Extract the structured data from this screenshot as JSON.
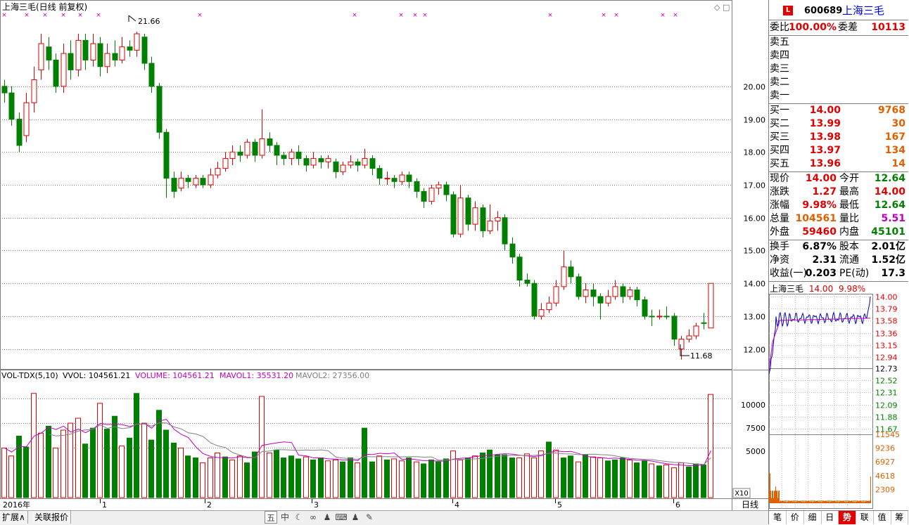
{
  "main": {
    "title": "上海三毛(日线 前复权)",
    "high_marker": "21.66",
    "low_marker": "11.68",
    "price_axis": [
      "20.00",
      "19.00",
      "18.00",
      "17.00",
      "16.00",
      "15.00",
      "14.00",
      "13.00",
      "12.00"
    ],
    "vol_header": {
      "name": "VOL-TDX(5,10)",
      "vvol": "VVOL: 104561.21",
      "volume": "VOLUME: 104561.21",
      "mavol1": "MAVOL1: 35531.20",
      "mavol2": "MAVOL2: 27356.00"
    },
    "vol_axis": [
      "10000",
      "7500",
      "5000"
    ],
    "vol_unit": "X10",
    "date_labels": [
      "2016年",
      "1",
      "2",
      "3",
      "4",
      "5",
      "6"
    ],
    "period_label": "日线"
  },
  "bottom_bar": {
    "tabs": [
      "扩展∧",
      "关联报价"
    ],
    "tools": [
      "五",
      "中",
      "☾",
      "∞",
      "♟",
      "⌨",
      "♟",
      "✎"
    ]
  },
  "quote": {
    "code": "600689",
    "name": "上海三毛",
    "logo": "L",
    "weibi_label": "委比",
    "weibi": "100.00%",
    "weicha_label": "委差",
    "weicha": "10113",
    "sell": [
      {
        "label": "卖五",
        "price": "",
        "vol": ""
      },
      {
        "label": "卖四",
        "price": "",
        "vol": ""
      },
      {
        "label": "卖三",
        "price": "",
        "vol": ""
      },
      {
        "label": "卖二",
        "price": "",
        "vol": ""
      },
      {
        "label": "卖一",
        "price": "",
        "vol": ""
      }
    ],
    "buy": [
      {
        "label": "买一",
        "price": "14.00",
        "vol": "9768"
      },
      {
        "label": "买二",
        "price": "13.99",
        "vol": "30"
      },
      {
        "label": "买三",
        "price": "13.98",
        "vol": "167"
      },
      {
        "label": "买四",
        "price": "13.97",
        "vol": "134"
      },
      {
        "label": "买五",
        "price": "13.96",
        "vol": "14"
      }
    ],
    "stats": [
      {
        "l1": "现价",
        "v1": "14.00",
        "c1": "red",
        "l2": "今开",
        "v2": "12.64",
        "c2": "green"
      },
      {
        "l1": "涨跌",
        "v1": "1.27",
        "c1": "red",
        "l2": "最高",
        "v2": "14.00",
        "c2": "red"
      },
      {
        "l1": "涨幅",
        "v1": "9.98%",
        "c1": "red",
        "l2": "最低",
        "v2": "12.64",
        "c2": "green"
      },
      {
        "l1": "总量",
        "v1": "104561",
        "c1": "orange",
        "l2": "量比",
        "v2": "5.51",
        "c2": "purple"
      },
      {
        "l1": "外盘",
        "v1": "59460",
        "c1": "red",
        "l2": "内盘",
        "v2": "45101",
        "c2": "green"
      }
    ],
    "stats2": [
      {
        "l1": "换手",
        "v1": "6.87%",
        "l2": "股本",
        "v2": "2.01亿"
      },
      {
        "l1": "净资",
        "v1": "2.31",
        "l2": "流通",
        "v2": "1.52亿"
      },
      {
        "l1": "收益(一)",
        "v1": "0.203",
        "l2": "PE(动)",
        "v2": "17.3"
      }
    ],
    "mini_title": "上海三毛",
    "mini_price": "14.00",
    "mini_pct": "9.98%",
    "mini_price_axis": [
      "14.00",
      "13.79",
      "13.58",
      "13.36",
      "13.15",
      "12.94",
      "12.73",
      "12.52",
      "12.31",
      "12.09",
      "11.88",
      "11.67"
    ],
    "mini_vol_axis": [
      "11545",
      "9236",
      "6927",
      "4618",
      "2309"
    ],
    "tabs": [
      "笔",
      "价",
      "细",
      "日",
      "势",
      "联",
      "值",
      "筹"
    ],
    "active_tab": "势"
  },
  "chart_data": {
    "type": "candlestick",
    "price_range": [
      11.5,
      22.2
    ],
    "volume_range": [
      0,
      11545
    ],
    "candles": [
      [
        20.0,
        19.8,
        20.2,
        19.5,
        "d"
      ],
      [
        19.8,
        19.0,
        20.0,
        18.8,
        "d"
      ],
      [
        19.0,
        18.2,
        19.2,
        18.0,
        "d"
      ],
      [
        18.5,
        19.5,
        19.8,
        18.3,
        "u"
      ],
      [
        19.5,
        20.2,
        20.6,
        19.2,
        "u"
      ],
      [
        20.5,
        21.3,
        21.6,
        20.2,
        "u"
      ],
      [
        21.2,
        20.8,
        21.5,
        20.5,
        "d"
      ],
      [
        20.8,
        20.0,
        21.0,
        19.8,
        "d"
      ],
      [
        20.0,
        21.0,
        21.3,
        19.8,
        "u"
      ],
      [
        21.0,
        20.5,
        21.4,
        20.2,
        "d"
      ],
      [
        20.5,
        21.4,
        21.6,
        20.3,
        "u"
      ],
      [
        21.4,
        20.8,
        21.6,
        20.5,
        "d"
      ],
      [
        20.8,
        21.3,
        21.6,
        20.6,
        "u"
      ],
      [
        21.3,
        20.6,
        21.5,
        20.3,
        "d"
      ],
      [
        20.6,
        21.0,
        21.3,
        20.4,
        "u"
      ],
      [
        21.0,
        20.8,
        21.4,
        20.6,
        "d"
      ],
      [
        20.8,
        21.2,
        21.5,
        20.7,
        "u"
      ],
      [
        21.2,
        21.1,
        21.4,
        20.9,
        "d"
      ],
      [
        21.1,
        21.6,
        21.66,
        20.9,
        "u"
      ],
      [
        21.5,
        20.7,
        21.6,
        20.5,
        "d"
      ],
      [
        20.7,
        20.0,
        20.9,
        19.8,
        "d"
      ],
      [
        20.0,
        18.6,
        20.1,
        18.4,
        "d"
      ],
      [
        18.6,
        17.2,
        18.7,
        16.6,
        "d"
      ],
      [
        17.2,
        16.8,
        17.4,
        16.6,
        "d"
      ],
      [
        16.9,
        17.2,
        17.4,
        16.8,
        "u"
      ],
      [
        17.2,
        17.1,
        17.3,
        16.9,
        "d"
      ],
      [
        17.0,
        17.2,
        17.3,
        16.9,
        "u"
      ],
      [
        17.2,
        17.0,
        17.3,
        16.9,
        "d"
      ],
      [
        17.0,
        17.3,
        17.5,
        16.9,
        "u"
      ],
      [
        17.3,
        17.5,
        17.7,
        17.2,
        "u"
      ],
      [
        17.5,
        17.8,
        18.0,
        17.4,
        "u"
      ],
      [
        17.8,
        18.0,
        18.2,
        17.6,
        "u"
      ],
      [
        18.0,
        17.9,
        18.2,
        17.7,
        "d"
      ],
      [
        17.9,
        18.3,
        18.4,
        17.8,
        "u"
      ],
      [
        18.3,
        17.9,
        18.4,
        17.7,
        "d"
      ],
      [
        17.9,
        18.4,
        19.3,
        17.8,
        "u"
      ],
      [
        18.4,
        18.2,
        18.6,
        18.0,
        "d"
      ],
      [
        18.2,
        17.9,
        18.3,
        17.6,
        "d"
      ],
      [
        17.9,
        17.8,
        18.0,
        17.6,
        "d"
      ],
      [
        17.8,
        18.0,
        18.1,
        17.6,
        "u"
      ],
      [
        18.0,
        17.8,
        18.2,
        17.6,
        "d"
      ],
      [
        17.8,
        17.6,
        17.9,
        17.4,
        "d"
      ],
      [
        17.6,
        17.8,
        18.0,
        17.5,
        "u"
      ],
      [
        17.8,
        17.7,
        17.9,
        17.5,
        "d"
      ],
      [
        17.7,
        17.8,
        17.9,
        17.5,
        "u"
      ],
      [
        17.7,
        17.4,
        17.8,
        17.2,
        "d"
      ],
      [
        17.4,
        17.6,
        17.7,
        17.3,
        "u"
      ],
      [
        17.6,
        17.7,
        17.9,
        17.5,
        "u"
      ],
      [
        17.7,
        17.6,
        17.8,
        17.4,
        "d"
      ],
      [
        17.6,
        17.8,
        18.1,
        17.5,
        "u"
      ],
      [
        17.8,
        17.5,
        17.9,
        17.3,
        "d"
      ],
      [
        17.5,
        17.2,
        17.6,
        17.0,
        "d"
      ],
      [
        17.2,
        17.2,
        17.4,
        17.0,
        "u"
      ],
      [
        17.2,
        17.1,
        17.3,
        16.9,
        "d"
      ],
      [
        17.1,
        17.3,
        17.4,
        17.0,
        "u"
      ],
      [
        17.3,
        17.1,
        17.4,
        16.9,
        "d"
      ],
      [
        17.1,
        16.8,
        17.2,
        16.6,
        "d"
      ],
      [
        16.8,
        16.5,
        16.9,
        16.3,
        "d"
      ],
      [
        16.5,
        16.9,
        17.0,
        16.4,
        "u"
      ],
      [
        16.9,
        17.0,
        17.1,
        16.7,
        "u"
      ],
      [
        17.0,
        16.7,
        17.1,
        16.5,
        "d"
      ],
      [
        16.7,
        15.5,
        16.8,
        15.4,
        "d"
      ],
      [
        15.5,
        16.6,
        17.0,
        15.4,
        "u"
      ],
      [
        16.6,
        15.8,
        16.7,
        15.6,
        "d"
      ],
      [
        15.8,
        16.3,
        16.5,
        15.6,
        "u"
      ],
      [
        16.3,
        15.6,
        16.4,
        15.4,
        "d"
      ],
      [
        15.6,
        15.9,
        16.4,
        15.5,
        "u"
      ],
      [
        15.9,
        16.0,
        16.2,
        15.6,
        "u"
      ],
      [
        16.0,
        15.2,
        16.1,
        15.0,
        "d"
      ],
      [
        15.2,
        14.8,
        15.4,
        14.6,
        "d"
      ],
      [
        14.8,
        14.1,
        14.9,
        13.9,
        "d"
      ],
      [
        14.1,
        14.0,
        14.3,
        13.9,
        "d"
      ],
      [
        14.0,
        13.0,
        14.1,
        12.9,
        "d"
      ],
      [
        13.0,
        13.2,
        13.4,
        12.9,
        "u"
      ],
      [
        13.2,
        13.4,
        13.6,
        13.1,
        "u"
      ],
      [
        13.4,
        13.9,
        14.1,
        13.3,
        "u"
      ],
      [
        13.9,
        14.5,
        15.0,
        13.8,
        "u"
      ],
      [
        14.5,
        14.2,
        14.7,
        14.0,
        "d"
      ],
      [
        14.2,
        13.6,
        14.3,
        13.5,
        "d"
      ],
      [
        13.6,
        13.8,
        14.0,
        13.4,
        "u"
      ],
      [
        13.8,
        13.6,
        14.0,
        13.3,
        "d"
      ],
      [
        13.6,
        13.4,
        13.7,
        12.9,
        "d"
      ],
      [
        13.4,
        13.6,
        13.8,
        13.3,
        "u"
      ],
      [
        13.6,
        13.9,
        14.1,
        13.5,
        "u"
      ],
      [
        13.9,
        13.6,
        14.0,
        13.4,
        "d"
      ],
      [
        13.6,
        13.8,
        13.9,
        13.5,
        "u"
      ],
      [
        13.8,
        13.5,
        13.9,
        13.3,
        "d"
      ],
      [
        13.5,
        13.0,
        13.6,
        12.9,
        "d"
      ],
      [
        13.0,
        13.0,
        13.2,
        12.7,
        "d"
      ],
      [
        13.0,
        13.0,
        13.2,
        12.9,
        "u"
      ],
      [
        13.0,
        13.0,
        13.3,
        12.9,
        "d"
      ],
      [
        13.0,
        12.3,
        13.1,
        12.1,
        "d"
      ],
      [
        12.0,
        12.3,
        12.4,
        11.68,
        "u"
      ],
      [
        12.3,
        12.4,
        12.6,
        12.2,
        "u"
      ],
      [
        12.4,
        12.7,
        12.8,
        12.3,
        "u"
      ],
      [
        12.8,
        12.8,
        13.1,
        12.6,
        "d"
      ],
      [
        12.64,
        14.0,
        14.0,
        12.64,
        "u"
      ]
    ],
    "volumes": [
      5000,
      4200,
      6200,
      5100,
      10500,
      6500,
      7200,
      5000,
      6800,
      7500,
      8000,
      5400,
      7000,
      9500,
      6900,
      8200,
      5200,
      6000,
      10500,
      7500,
      5800,
      8800,
      6800,
      5500,
      5000,
      4200,
      4000,
      3500,
      4000,
      4500,
      4100,
      3800,
      4200,
      3500,
      4600,
      10200,
      4500,
      4800,
      4000,
      4200,
      3900,
      4100,
      3800,
      4000,
      3700,
      3800,
      3600,
      4000,
      3500,
      7000,
      3600,
      4200,
      3800,
      3900,
      3700,
      4000,
      3600,
      3400,
      3800,
      3600,
      3900,
      4700,
      3800,
      4000,
      4200,
      4500,
      4800,
      4300,
      4300,
      4000,
      4000,
      4400,
      4000,
      4700,
      5600,
      4800,
      4000,
      4200,
      3600,
      4300,
      4100,
      4000,
      3700,
      3800,
      4000,
      3800,
      3500,
      3700,
      3400,
      3200,
      3300,
      3000,
      3500,
      3100,
      3400,
      3300,
      10400
    ],
    "vol_colors": "uudduuduuuudduddudduddddudduuuduudduuddddudduuddudduduududddduududdddduuuududduduudddudduduuudddu"
  }
}
